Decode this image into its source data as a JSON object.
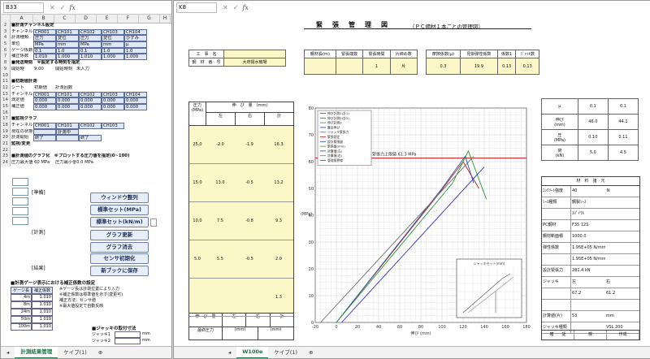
{
  "left_pane": {
    "name_box": "B33",
    "formula_fx": "fx",
    "columns": [
      "A",
      "B",
      "C",
      "D",
      "E",
      "F",
      "G",
      "H"
    ],
    "rows": [
      {
        "n": "2",
        "cells": [
          "■計測チャンネル設定"
        ]
      },
      {
        "n": "3",
        "cells": [
          "チャンネル",
          "CH001",
          "CH101",
          "CH102",
          "CH103",
          "CH104"
        ]
      },
      {
        "n": "4",
        "cells": [
          "計測種類",
          "圧力",
          "変位",
          "圧力",
          "変位",
          "ひずみ"
        ]
      },
      {
        "n": "5",
        "cells": [
          "単位",
          "MPa",
          "mm",
          "MPa",
          "mm",
          "μ"
        ]
      },
      {
        "n": "6",
        "cells": [
          "ゲージ係数",
          "0.1",
          "1.0",
          "0.1",
          "1.0",
          "1.0"
        ]
      },
      {
        "n": "7",
        "cells": [
          "補正係数",
          "1.010",
          "1.000",
          "1.010",
          "1.000",
          "1.000"
        ]
      },
      {
        "n": "8",
        "cells": [
          "■発送時刻",
          "※設定する時刻を指定"
        ]
      },
      {
        "n": "9",
        "cells": [
          "開始時",
          "9:00",
          "開始時刻",
          "未入力"
        ]
      },
      {
        "n": "10",
        "cells": [
          ""
        ]
      },
      {
        "n": "11",
        "cells": [
          "■初期値計測"
        ]
      },
      {
        "n": "12",
        "cells": [
          "シート",
          "初期値",
          "計測回数"
        ]
      },
      {
        "n": "13",
        "cells": [
          "チャンネル",
          "CH001",
          "CH101",
          "CH102",
          "CH103",
          "CH104"
        ]
      },
      {
        "n": "14",
        "cells": [
          "測定値",
          "0.000",
          "0.000",
          "0.000",
          "0.000",
          "0.000"
        ]
      },
      {
        "n": "15",
        "cells": [
          "補正値",
          "0.000",
          "0.000",
          "0.000",
          "0.000",
          "0.000"
        ]
      },
      {
        "n": "16",
        "cells": [
          ""
        ]
      },
      {
        "n": "17",
        "cells": [
          "■監視グラフ"
        ]
      },
      {
        "n": "18",
        "cells": [
          "チャンネル",
          "CH001",
          "CH101",
          "CH102",
          "CH103"
        ]
      },
      {
        "n": "19",
        "cells": [
          "現在の状態",
          "",
          "計測中"
        ]
      },
      {
        "n": "20",
        "cells": [
          "計測開始",
          "終了",
          "",
          "終了"
        ]
      },
      {
        "n": "21",
        "cells": [
          "監視/変更"
        ]
      },
      {
        "n": "22",
        "cells": [
          ""
        ]
      },
      {
        "n": "23",
        "cells": [
          "■計測値のグラフ化",
          "※プロットする圧力値を指定(0~100)"
        ]
      },
      {
        "n": "24",
        "cells": [
          "圧力最大値",
          "60 MPa",
          "圧力最小値",
          "0.0 MPa"
        ]
      }
    ],
    "buttons": {
      "window_arrange": "ウィンドウ整列",
      "manual_set_1": "標準セット(MPa)",
      "manual_set_2": "標準セット(kN/m)",
      "graph_update": "グラフ更新",
      "graph_reset": "グラフ消去",
      "sensor_reset": "センサ初期化",
      "save_book": "新ブックに保存"
    },
    "labels": {
      "monitor": "[準備]",
      "graph": "[計測]",
      "save": "[結果]"
    },
    "bottom_section": {
      "title": "■計測ゲージ表示における補正係数の設定",
      "head": [
        "ゲージ長",
        "補正係数"
      ],
      "rows": [
        [
          "4m",
          "1.010"
        ],
        [
          "8m",
          "1.010"
        ],
        [
          "24m",
          "1.010"
        ],
        [
          "50m",
          "1.010"
        ],
        [
          "100m",
          "1.010"
        ]
      ],
      "notes": [
        "※ゲージ長は計測位置により入力",
        "※補正係数は標準値を示す(変更可)",
        "補正方法：センサ値",
        "※最大値設定で自動反映"
      ],
      "jack_title": "■ジャッキの取付寸法",
      "jack_rows": [
        [
          "ジャッキ1",
          "",
          "mm"
        ],
        [
          "ジャッキ2",
          "",
          "mm"
        ]
      ]
    },
    "tabs": [
      "計測結果管理",
      "ケイブ(1)"
    ]
  },
  "right_pane": {
    "name_box": "K8",
    "formula_fx": "fx",
    "doc_title": "緊　張　管　理　図",
    "doc_subtitle": "（ＰＣ鋼材１本ごとの管理図）",
    "info_labels": [
      "工　事　名",
      "鋼　材　番　号"
    ],
    "info_value": "大府揚水機場",
    "head_cols": [
      "鋼材長(ｍ)",
      "緊張端数",
      "緊張時間",
      "片締め数"
    ],
    "head_vals": [
      "",
      "",
      "1",
      "片"
    ],
    "stat_cols": [
      "摩擦係数(μ)",
      "見掛弾性係数",
      "係数1",
      "ｼﾞｬｯｷ数"
    ],
    "stat_vals": [
      "0.3",
      "19.9",
      "0.13",
      "0.13"
    ],
    "table": {
      "header": [
        "圧力\n(MPa)",
        "伸　び　量　(mm)"
      ],
      "sub": [
        "",
        "左",
        "右",
        "計"
      ],
      "rows": [
        [
          "25.0",
          "-2.0",
          "-1.9",
          "16.3"
        ],
        [
          "15.0",
          "13.0",
          "-0.5",
          "13.2"
        ],
        [
          "10.0",
          "7.5",
          "-0.8",
          "9.3"
        ],
        [
          "5.0",
          "5.5",
          "-0.5",
          "2.0"
        ],
        [
          "",
          "",
          "",
          "1.3"
        ]
      ],
      "footer": [
        "伸　び　量",
        "左",
        "右",
        "計"
      ],
      "footer2": [
        "最終圧力",
        "(mm)",
        "(mm)"
      ]
    },
    "chart_data": {
      "type": "line",
      "title": "",
      "legend": [
        "伸び計測1(計1)",
        "伸び計測2(計2)",
        "伸び計測3",
        "算出伸び",
        "ジャッキ緊張力",
        "緊張設定",
        "設計緊張量",
        "緊張量(mm)",
        "計算値(左)",
        "計算値(右)",
        "管理限界線"
      ],
      "ref_label": "緊張力上限値 61.3 MPa",
      "ref_y": 61.3,
      "ylabel": "(MPa)",
      "xlabel": "伸び (mm)",
      "xticks": [
        "-20",
        "0",
        "20",
        "40",
        "60",
        "80",
        "100",
        "120",
        "140",
        "160",
        "180"
      ],
      "yticks": [
        "0",
        "10",
        "20",
        "30",
        "40",
        "50",
        "60",
        "70",
        "80"
      ],
      "xlim": [
        -20,
        180
      ],
      "ylim": [
        0,
        80
      ],
      "series": [
        {
          "points": [
            [
              0,
              0
            ],
            [
              95,
              47
            ],
            [
              120,
              60
            ],
            [
              135,
              50
            ]
          ],
          "color": "#c02020"
        },
        {
          "points": [
            [
              0,
              0
            ],
            [
              100,
              50
            ],
            [
              122,
              62
            ],
            [
              130,
              52
            ]
          ],
          "color": "#2c4fb0"
        },
        {
          "points": [
            [
              0,
              0
            ],
            [
              110,
              52
            ],
            [
              125,
              64
            ],
            [
              142,
              46
            ]
          ],
          "color": "#2a9a3a"
        },
        {
          "points": [
            [
              5,
              0
            ],
            [
              140,
              58
            ]
          ],
          "color": "#3030c0"
        },
        {
          "points": [
            [
              -15,
              0
            ],
            [
              130,
              62
            ]
          ],
          "color": "#707070"
        }
      ],
      "inset_title": "ジャッキセット(mm)"
    },
    "side_table": [
      [
        "μ",
        "0.1",
        "0.1"
      ],
      [
        "伸び\n(mm)",
        "46.0",
        "44.1"
      ],
      [
        "圧\n(MPa)",
        "0.10",
        "0.11"
      ],
      [
        "荷\n(kN)",
        "5.0",
        "4.5"
      ]
    ],
    "spec": {
      "title": "材　料　諸　元",
      "rows": [
        [
          "ｺﾝｸﾘｰﾄ強度",
          "40",
          "Ｎ"
        ],
        [
          "ｼｰｽ種類",
          "鋼製ｼｰｽ",
          ""
        ],
        [
          "",
          "ｽﾊﾟｲﾗﾙ",
          ""
        ],
        [
          "PC鋼材",
          "F35 12S",
          ""
        ],
        [
          "鋼材断面積",
          "1000.0",
          ""
        ],
        [
          "弾性係数",
          "1.95E+05 N/mm2",
          ""
        ],
        [
          "",
          "1.95E+05 N/mm2",
          ""
        ],
        [
          "設計緊張力",
          "281.4 kN",
          ""
        ],
        [
          "ジャッキ",
          "左",
          "右"
        ],
        [
          "",
          "67.2",
          "61.2"
        ],
        [
          "",
          ""
        ],
        [
          "計算値(片)",
          "53",
          "mm"
        ],
        [
          "ジャッキ種類",
          "",
          "VSL 200"
        ]
      ],
      "bottom": [
        "確　　認",
        "検",
        "作成"
      ]
    },
    "tabs": [
      "W100e",
      "ケイブ(1)"
    ]
  }
}
